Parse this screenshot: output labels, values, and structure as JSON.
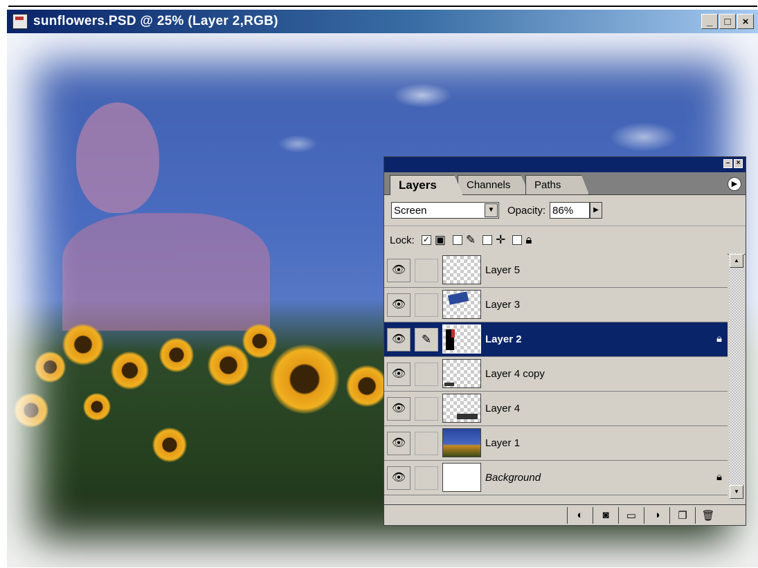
{
  "window": {
    "title": "sunflowers.PSD @ 25% (Layer 2,RGB)",
    "minimize": "_",
    "maximize": "□",
    "close": "×"
  },
  "layers_palette": {
    "tabs": [
      "Layers",
      "Channels",
      "Paths"
    ],
    "active_tab": "Layers",
    "blend_mode": "Screen",
    "opacity_label": "Opacity:",
    "opacity_value": "86%",
    "lock_label": "Lock:",
    "layers": [
      {
        "name": "Layer 5",
        "thumb": "empty",
        "selected": false,
        "locked": false
      },
      {
        "name": "Layer 3",
        "thumb": "partial",
        "selected": false,
        "locked": false
      },
      {
        "name": "Layer 2",
        "thumb": "figure",
        "selected": true,
        "locked": true
      },
      {
        "name": "Layer 4 copy",
        "thumb": "partial",
        "selected": false,
        "locked": false
      },
      {
        "name": "Layer 4",
        "thumb": "partial",
        "selected": false,
        "locked": false
      },
      {
        "name": "Layer 1",
        "thumb": "sky",
        "selected": false,
        "locked": false
      },
      {
        "name": "Background",
        "thumb": "blank",
        "selected": false,
        "locked": true
      }
    ],
    "bottom_buttons": [
      "layer-style-icon",
      "mask-icon",
      "folder-icon",
      "adjustment-icon",
      "new-layer-icon",
      "trash-icon"
    ]
  },
  "colors": {
    "title_bar": "#0a246a",
    "selection": "#0a246a",
    "panel_bg": "#d4d0c8"
  }
}
